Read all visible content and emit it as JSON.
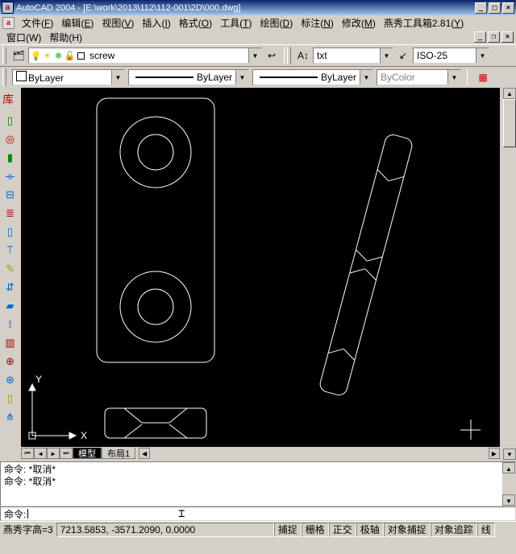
{
  "titlebar": {
    "app_icon": "a",
    "title": "AutoCAD 2004 - [E:\\work\\2013\\112\\112-001\\2D\\000.dwg]"
  },
  "menu": {
    "items": [
      {
        "label": "文件",
        "key": "F"
      },
      {
        "label": "编辑",
        "key": "E"
      },
      {
        "label": "视图",
        "key": "V"
      },
      {
        "label": "插入",
        "key": "I"
      },
      {
        "label": "格式",
        "key": "O"
      },
      {
        "label": "工具",
        "key": "T"
      },
      {
        "label": "绘图",
        "key": "D"
      },
      {
        "label": "标注",
        "key": "N"
      },
      {
        "label": "修改",
        "key": "M"
      },
      {
        "label": "燕秀工具箱2.81",
        "key": "Y"
      }
    ],
    "row2": [
      {
        "label": "窗口",
        "key": "W"
      },
      {
        "label": "帮助",
        "key": "H"
      }
    ]
  },
  "toolbar1": {
    "layer_combo": "screw",
    "textstyle": "txt",
    "dimstyle": "ISO-25"
  },
  "propbar": {
    "color": "ByLayer",
    "linetype": "ByLayer",
    "lineweight": "ByLayer",
    "plotstyle": "ByColor"
  },
  "sidebar_label": "库",
  "ucs": {
    "x": "X",
    "y": "Y"
  },
  "tabs": {
    "model": "模型",
    "layout1": "布局1"
  },
  "command": {
    "history": [
      "命令:  *取消*",
      "命令:  *取消*",
      ""
    ],
    "prompt": "命令: "
  },
  "status": {
    "left": "燕秀字高=3",
    "coords": "7213.5853, -3571.2090, 0.0000",
    "buttons": [
      "捕捉",
      "栅格",
      "正交",
      "极轴",
      "对象捕捉",
      "对象追踪",
      "线"
    ]
  }
}
